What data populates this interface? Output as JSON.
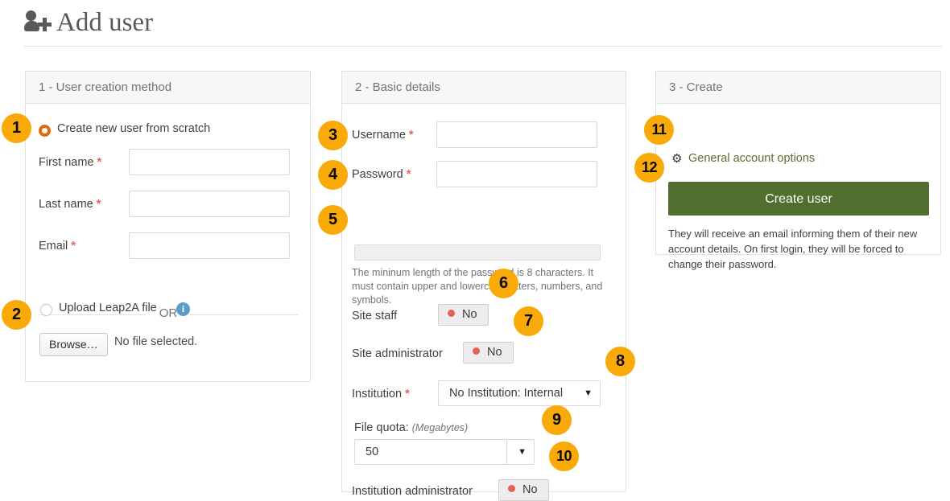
{
  "page": {
    "title": "Add user",
    "title_icon": "user-add-icon"
  },
  "panels": [
    {
      "id": "panel-1",
      "heading": "1 - User creation method",
      "scratch_option": {
        "label": "Create new user from scratch",
        "selected": true
      },
      "fields": [
        {
          "label": "First name",
          "required_mark": "*",
          "value": ""
        },
        {
          "label": "Last name",
          "required_mark": "*",
          "value": ""
        },
        {
          "label": "Email",
          "required_mark": "*",
          "value": ""
        }
      ],
      "divider_text": "OR",
      "upload_option": {
        "label": "Upload Leap2A file",
        "selected": false,
        "info_icon": "info-icon",
        "info_glyph": "i"
      },
      "file_input": {
        "browse_label": "Browse…",
        "file_status": "No file selected."
      }
    },
    {
      "id": "panel-2",
      "heading": "2 - Basic details",
      "fields": [
        {
          "label": "Username",
          "required_mark": "*",
          "value": ""
        },
        {
          "label": "Password",
          "required_mark": "*",
          "value": ""
        }
      ],
      "password_meter": {
        "strength_percent": 0
      },
      "password_help": "The mininum length of the password is 8 characters. It must contain upper and lowercase letters, numbers, and symbols.",
      "toggles": [
        {
          "label": "Site staff",
          "value": "No",
          "state_color": "#e8605a"
        },
        {
          "label": "Site administrator",
          "value": "No",
          "state_color": "#e8605a"
        },
        {
          "label": "Institution administrator",
          "value": "No",
          "state_color": "#e8605a"
        }
      ],
      "institution": {
        "label": "Institution",
        "required_mark": "*",
        "selected": "No Institution: Internal",
        "caret_glyph": "▼"
      },
      "file_quota": {
        "label": "File quota:",
        "units": "(Megabytes)",
        "selected": "50",
        "caret_glyph": "▼"
      }
    },
    {
      "id": "panel-3",
      "heading": "3 - Create",
      "general_options": {
        "label": "General account options",
        "icon": "gear-icon",
        "icon_glyph": "⚙"
      },
      "create_button": {
        "label": "Create user",
        "color": "#506f2f"
      },
      "note": "They will receive an email informing them of their new account details. On first login, they will be forced to change their password."
    }
  ],
  "callouts": [
    {
      "number": "1",
      "target": "create-from-scratch-radio"
    },
    {
      "number": "2",
      "target": "upload-leap2a-radio"
    },
    {
      "number": "3",
      "target": "username-field"
    },
    {
      "number": "4",
      "target": "password-field"
    },
    {
      "number": "5",
      "target": "password-strength-meter"
    },
    {
      "number": "6",
      "target": "site-staff-toggle"
    },
    {
      "number": "7",
      "target": "site-administrator-toggle"
    },
    {
      "number": "8",
      "target": "institution-select"
    },
    {
      "number": "9",
      "target": "file-quota-select"
    },
    {
      "number": "10",
      "target": "institution-administrator-toggle"
    },
    {
      "number": "11",
      "target": "general-account-options-link"
    },
    {
      "number": "12",
      "target": "create-user-button"
    }
  ],
  "theme": {
    "badge_color": "#f9a908",
    "accent_green": "#506f2f",
    "required_red": "#e8605a",
    "info_blue": "#5b9bc9",
    "radio_orange": "#dd6b12"
  }
}
